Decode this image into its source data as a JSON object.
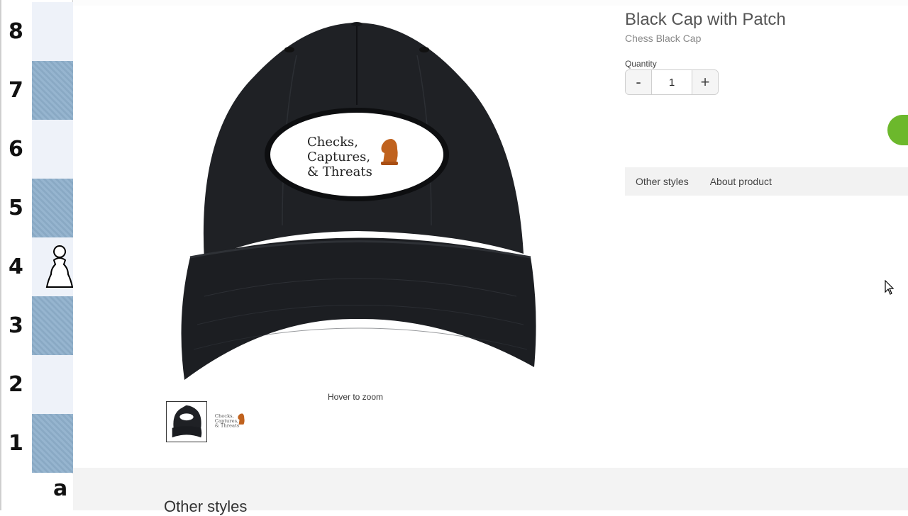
{
  "board": {
    "ranks": [
      "8",
      "7",
      "6",
      "5",
      "4",
      "3",
      "2",
      "1"
    ],
    "file_label": "a",
    "piece": {
      "name": "white-pawn",
      "rank": "4"
    }
  },
  "product": {
    "title": "Black Cap with Patch",
    "subtitle": "Chess Black Cap",
    "patch_text": [
      "Checks,",
      "Captures,",
      "& Threats"
    ],
    "hover_zoom": "Hover to zoom",
    "thumb_text": [
      "Checks,",
      "Captures,",
      "& Threats"
    ]
  },
  "quantity": {
    "label": "Quantity",
    "minus_label": "-",
    "value": "1",
    "plus_label": "+"
  },
  "tabs": [
    {
      "label": "Other styles"
    },
    {
      "label": "About product"
    }
  ],
  "bottom": {
    "heading": "Other styles"
  },
  "colors": {
    "accent_green": "#6cb82c",
    "board_dark": "#8fb0cc",
    "board_light": "#eef2f9",
    "cap_color": "#1f2125"
  }
}
